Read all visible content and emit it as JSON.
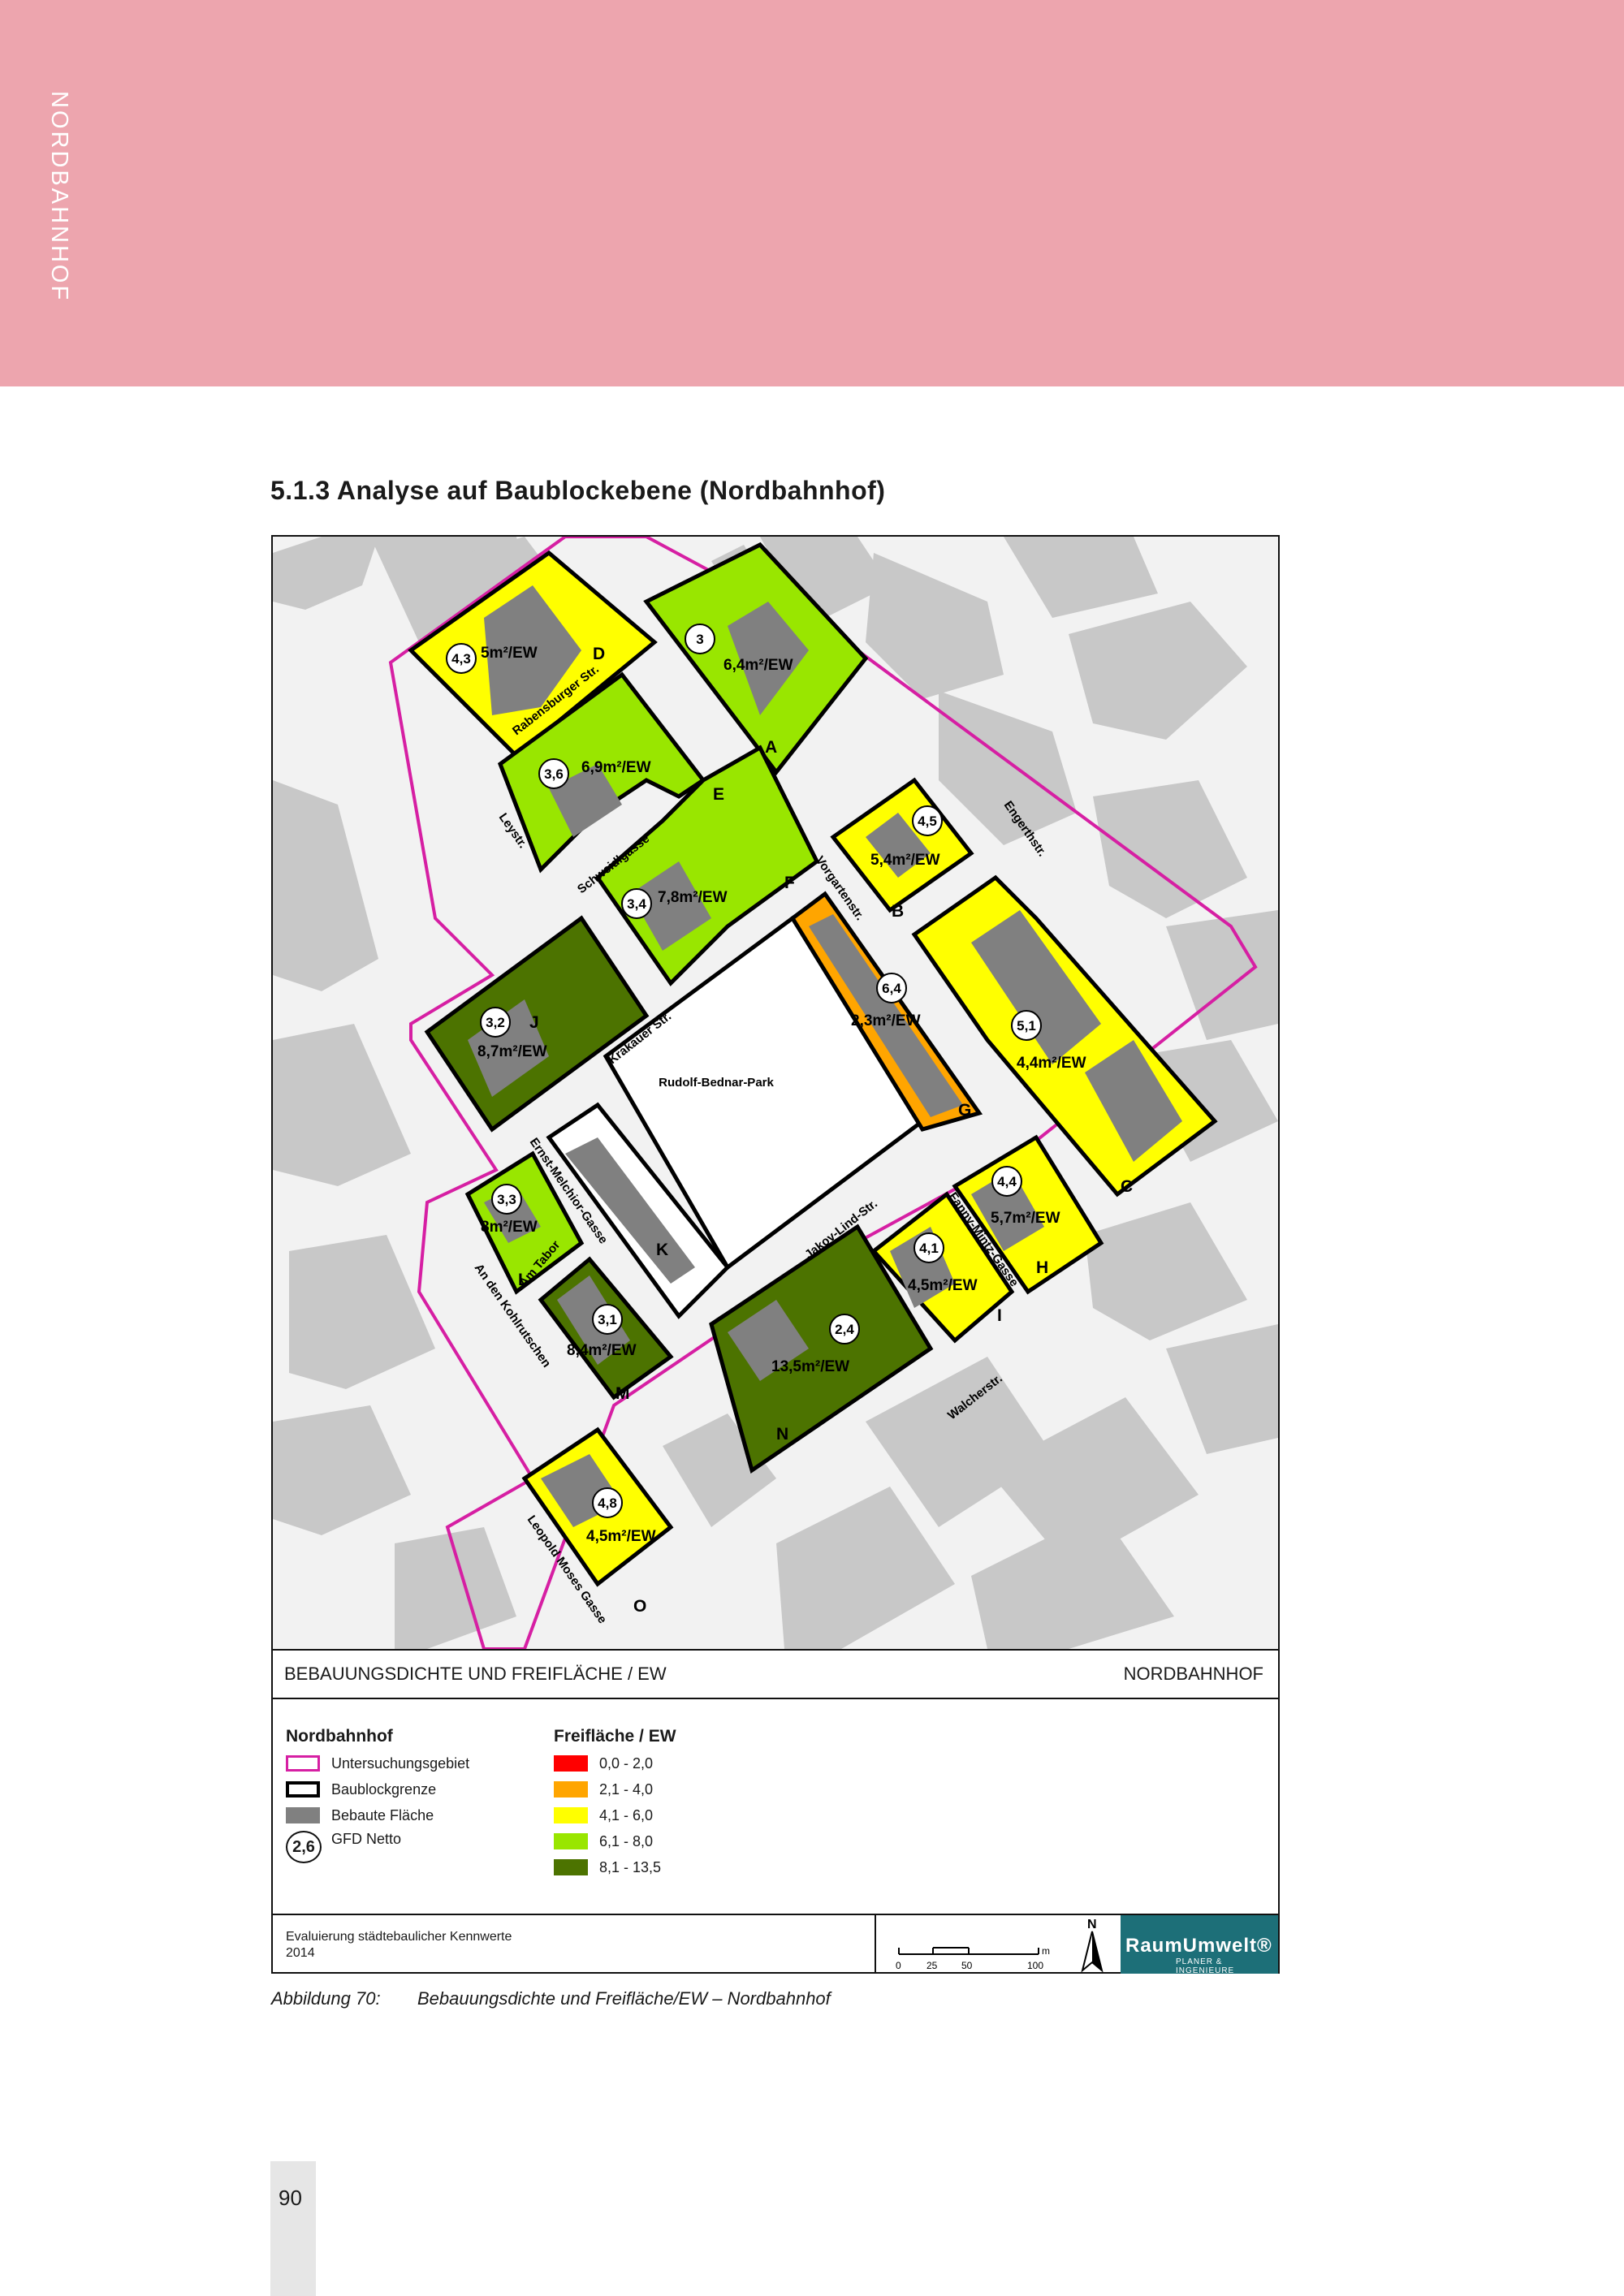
{
  "page": {
    "side_title": "NORDBAHNHOF",
    "section_heading": "5.1.3   Analyse auf Baublockebene (Nordbahnhof)",
    "page_number": "90",
    "header_color": "#eda5ae"
  },
  "map": {
    "title_left": "BEBAUUNGSDICHTE UND FREIFLÄCHE / EW",
    "title_right": "NORDBAHNHOF",
    "park_label": "Rudolf-Bednar-Park",
    "colors": {
      "boundary": "#d61fa3",
      "block_border": "#000000",
      "built": "#808080",
      "background_buildings": "#c8c8c8",
      "class_0_2": "#ff0000",
      "class_2_4": "#ffa500",
      "class_4_6": "#ffff00",
      "class_6_8": "#99e600",
      "class_8_13": "#4c7300"
    },
    "blocks": [
      {
        "id": "A",
        "gfd": "3",
        "freiflaeche": "6,4m²/EW"
      },
      {
        "id": "B",
        "gfd": "4,5",
        "freiflaeche": "5,4m²/EW"
      },
      {
        "id": "C",
        "gfd": "5,1",
        "freiflaeche": "4,4m²/EW"
      },
      {
        "id": "D",
        "gfd": "4,3",
        "freiflaeche": "5m²/EW"
      },
      {
        "id": "E",
        "gfd": "3,6",
        "freiflaeche": "6,9m²/EW"
      },
      {
        "id": "F",
        "gfd": "3,4",
        "freiflaeche": "7,8m²/EW"
      },
      {
        "id": "G",
        "gfd": "6,4",
        "freiflaeche": "2,3m²/EW"
      },
      {
        "id": "H",
        "gfd": "4,4",
        "freiflaeche": "5,7m²/EW"
      },
      {
        "id": "I",
        "gfd": "4,1",
        "freiflaeche": "4,5m²/EW"
      },
      {
        "id": "J",
        "gfd": "3,2",
        "freiflaeche": "8,7m²/EW"
      },
      {
        "id": "K",
        "gfd": "",
        "freiflaeche": ""
      },
      {
        "id": "L",
        "gfd": "3,3",
        "freiflaeche": "8m²/EW"
      },
      {
        "id": "M",
        "gfd": "3,1",
        "freiflaeche": "8,4m²/EW"
      },
      {
        "id": "N",
        "gfd": "2,4",
        "freiflaeche": "13,5m²/EW"
      },
      {
        "id": "O",
        "gfd": "4,8",
        "freiflaeche": "4,5m²/EW"
      }
    ],
    "streets": {
      "rabensburger": "Rabensburger Str.",
      "leystr": "Leystr.",
      "schweidl": "Schweidlgasse",
      "krakauer": "Krakauer Str.",
      "vorgarten": "Vorgartenstr.",
      "engerth": "Engerthstr.",
      "ernst": "Ernst-Melchior-Gasse",
      "kohlrutschen": "An den Kohlrutschen",
      "amtabor": "Am Tabor",
      "jakov": "Jakov-Lind-Str.",
      "fanny": "Fanny-Mintz-Gasse",
      "walcher": "Walcherstr.",
      "leopold": "Leopold Moses Gasse"
    }
  },
  "legend": {
    "group1_title": "Nordbahnhof",
    "group1_items": [
      "Untersuchungsgebiet",
      "Baublockgrenze",
      "Bebaute Fläche",
      "GFD Netto"
    ],
    "gfd_example": "2,6",
    "group2_title": "Freifläche / EW",
    "group2_items": [
      "0,0 - 2,0",
      "2,1 - 4,0",
      "4,1 - 6,0",
      "6,1 - 8,0",
      "8,1 - 13,5"
    ]
  },
  "footer": {
    "line1": "Evaluierung städtebaulicher Kennwerte",
    "line2": "2014",
    "scale_ticks": [
      "0",
      "25",
      "50",
      "100"
    ],
    "scale_unit": "m",
    "north": "N",
    "logo_main": "RaumUmwelt®",
    "logo_sub": "PLANER & INGENIEURE"
  },
  "caption": {
    "label": "Abbildung 70:",
    "text": "Bebauungsdichte und Freifläche/EW – Nordbahnhof"
  }
}
